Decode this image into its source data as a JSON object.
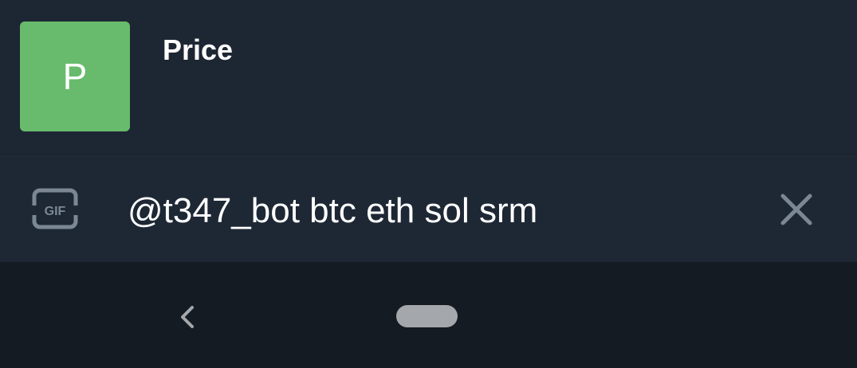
{
  "result": {
    "avatar_letter": "P",
    "title": "Price"
  },
  "input": {
    "query": "@t347_bot btc eth sol srm",
    "left_icon": "gif-icon",
    "right_icon": "close-icon"
  },
  "nav": {
    "back_icon": "chevron-left-icon",
    "home_icon": "home-pill"
  },
  "colors": {
    "background": "#1d2733",
    "avatar": "#68bb6c",
    "icon": "#7b8893",
    "nav_background": "#151b23",
    "home_pill": "#a4a8ad"
  }
}
